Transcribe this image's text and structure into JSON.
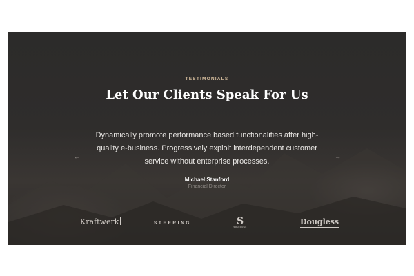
{
  "testimonials": {
    "eyebrow": "TESTIMONIALS",
    "heading": "Let Our Clients Speak For Us",
    "quote": "Dynamically promote performance based functionalities after high-quality e-business. Progressively exploit interdependent customer service without enterprise processes.",
    "author": "Michael Stanford",
    "role": "Financial Director",
    "prev_arrow": "←",
    "next_arrow": "→"
  },
  "logos": {
    "kraftwerk": "Kraftwerk",
    "steering": "STEERING",
    "squirrel_mark": "S",
    "squirrel_text": "SQUIRREL",
    "dougless": "Dougless"
  },
  "colors": {
    "background": "#2e2c2b",
    "eyebrow": "#d0b99a",
    "heading": "#ffffff",
    "muted": "#8f8a86"
  }
}
